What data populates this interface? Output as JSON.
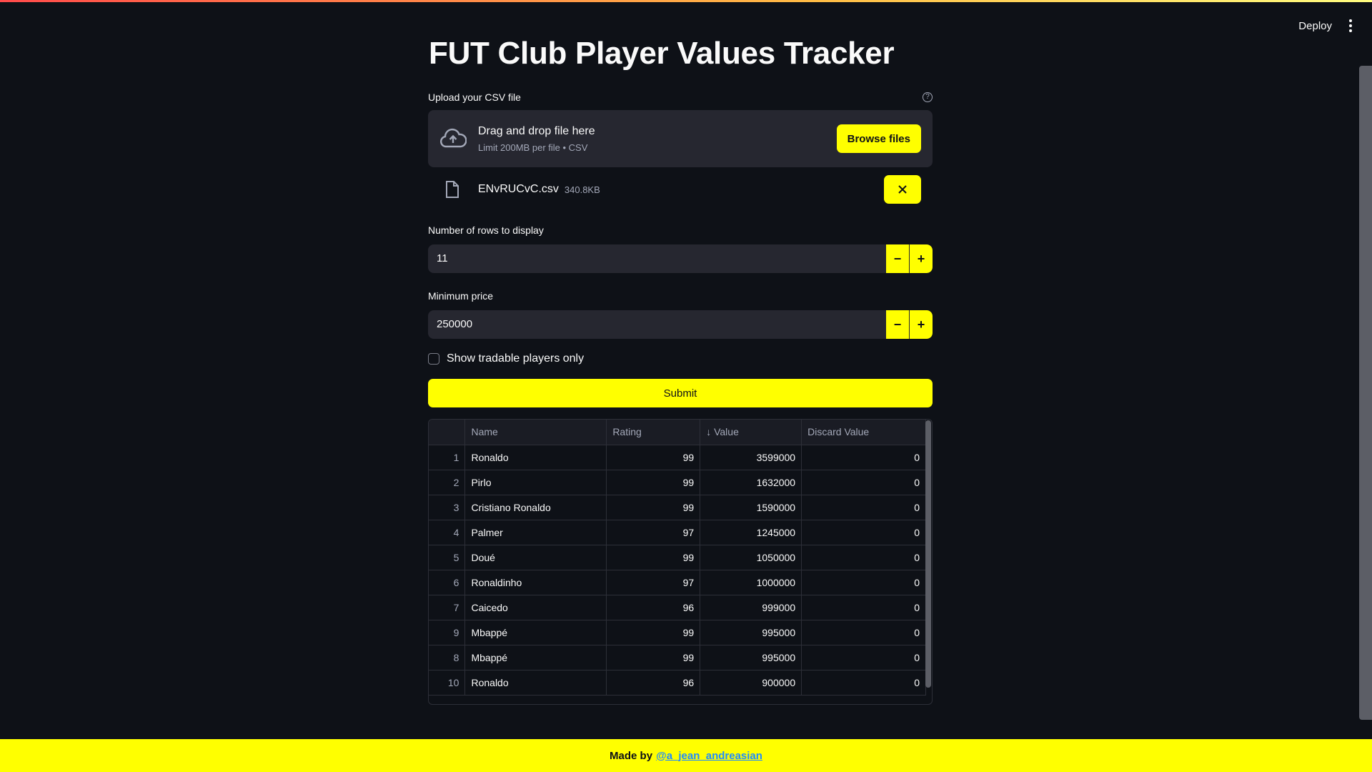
{
  "header": {
    "deploy_label": "Deploy"
  },
  "page": {
    "title": "FUT Club Player Values Tracker"
  },
  "uploader": {
    "label": "Upload your CSV file",
    "drop_title": "Drag and drop file here",
    "drop_subtitle": "Limit 200MB per file • CSV",
    "browse_label": "Browse files",
    "file_name": "ENvRUCvC.csv",
    "file_size": "340.8KB"
  },
  "rows_input": {
    "label": "Number of rows to display",
    "value": "11",
    "minus": "−",
    "plus": "+"
  },
  "price_input": {
    "label": "Minimum price",
    "value": "250000",
    "minus": "−",
    "plus": "+"
  },
  "tradable": {
    "label": "Show tradable players only",
    "checked": false
  },
  "submit_label": "Submit",
  "table": {
    "columns": [
      "",
      "Name",
      "Rating",
      "↓ Value",
      "Discard Value"
    ],
    "rows": [
      [
        "1",
        "Ronaldo",
        "99",
        "3599000",
        "0"
      ],
      [
        "2",
        "Pirlo",
        "99",
        "1632000",
        "0"
      ],
      [
        "3",
        "Cristiano Ronaldo",
        "99",
        "1590000",
        "0"
      ],
      [
        "4",
        "Palmer",
        "97",
        "1245000",
        "0"
      ],
      [
        "5",
        "Doué",
        "99",
        "1050000",
        "0"
      ],
      [
        "6",
        "Ronaldinho",
        "97",
        "1000000",
        "0"
      ],
      [
        "7",
        "Caicedo",
        "96",
        "999000",
        "0"
      ],
      [
        "9",
        "Mbappé",
        "99",
        "995000",
        "0"
      ],
      [
        "8",
        "Mbappé",
        "99",
        "995000",
        "0"
      ],
      [
        "10",
        "Ronaldo",
        "96",
        "900000",
        "0"
      ]
    ]
  },
  "footer": {
    "made_by": "Made by",
    "handle": "@a_jean_andreasian"
  }
}
